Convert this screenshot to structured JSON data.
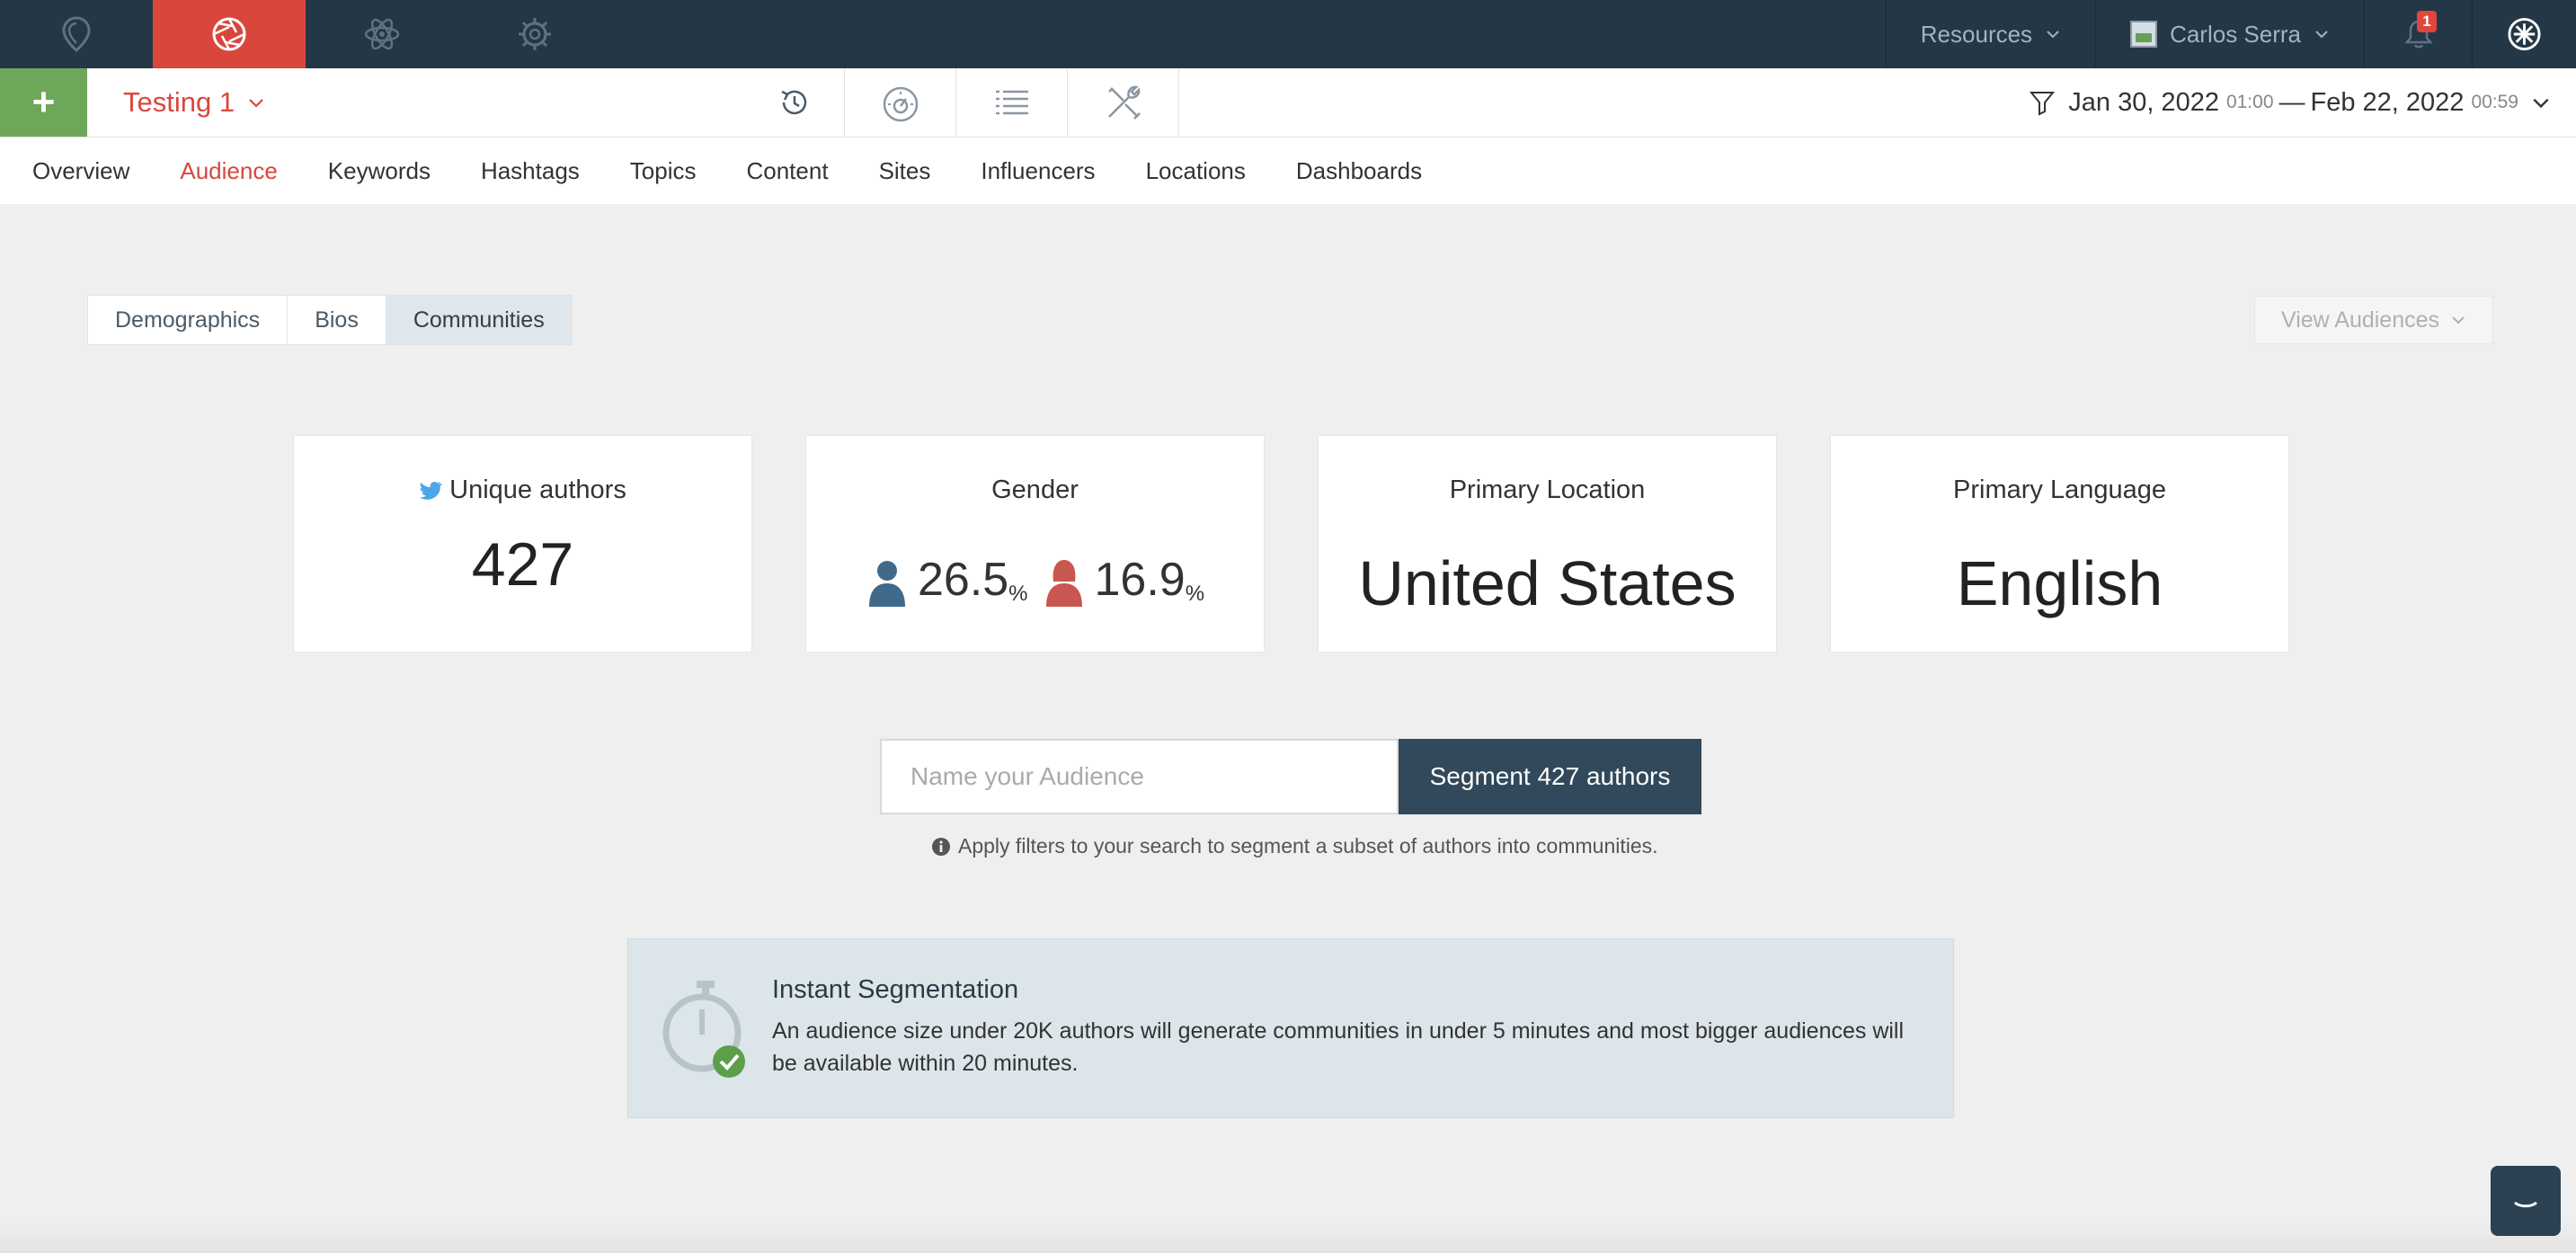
{
  "topbar": {
    "resources_label": "Resources",
    "user_name": "Carlos Serra",
    "notification_count": "1",
    "app_icons": [
      "location-pin-icon",
      "aperture-icon",
      "atom-icon",
      "settings-cog-icon"
    ],
    "accent_color": "#d9473c",
    "bg_color": "#243746"
  },
  "secondbar": {
    "add_label": "+",
    "project_name": "Testing 1",
    "tool_icons": [
      "history-icon",
      "speedometer-icon",
      "list-icon",
      "tools-icon"
    ],
    "date_start": "Jan 30, 2022",
    "time_start": "01:00",
    "dash": "—",
    "date_end": "Feb 22, 2022",
    "time_end": "00:59"
  },
  "nav": {
    "tabs": [
      "Overview",
      "Audience",
      "Keywords",
      "Hashtags",
      "Topics",
      "Content",
      "Sites",
      "Influencers",
      "Locations",
      "Dashboards"
    ],
    "active": "Audience"
  },
  "subtabs": {
    "items": [
      "Demographics",
      "Bios",
      "Communities"
    ],
    "active": "Communities",
    "view_audiences": "View Audiences"
  },
  "stats": {
    "unique_authors_label": "Unique authors",
    "unique_authors_value": "427",
    "gender_label": "Gender",
    "male_pct": "26.5",
    "female_pct": "16.9",
    "pct_sign": "%",
    "primary_location_label": "Primary Location",
    "primary_location_value": "United States",
    "primary_language_label": "Primary Language",
    "primary_language_value": "English"
  },
  "segment": {
    "placeholder": "Name your Audience",
    "button_label": "Segment 427 authors",
    "hint": "Apply filters to your search to segment a subset of authors into communities."
  },
  "infobox": {
    "title": "Instant Segmentation",
    "text": "An audience size under 20K authors will generate communities in under 5 minutes and most bigger audiences will be available within 20 minutes."
  }
}
